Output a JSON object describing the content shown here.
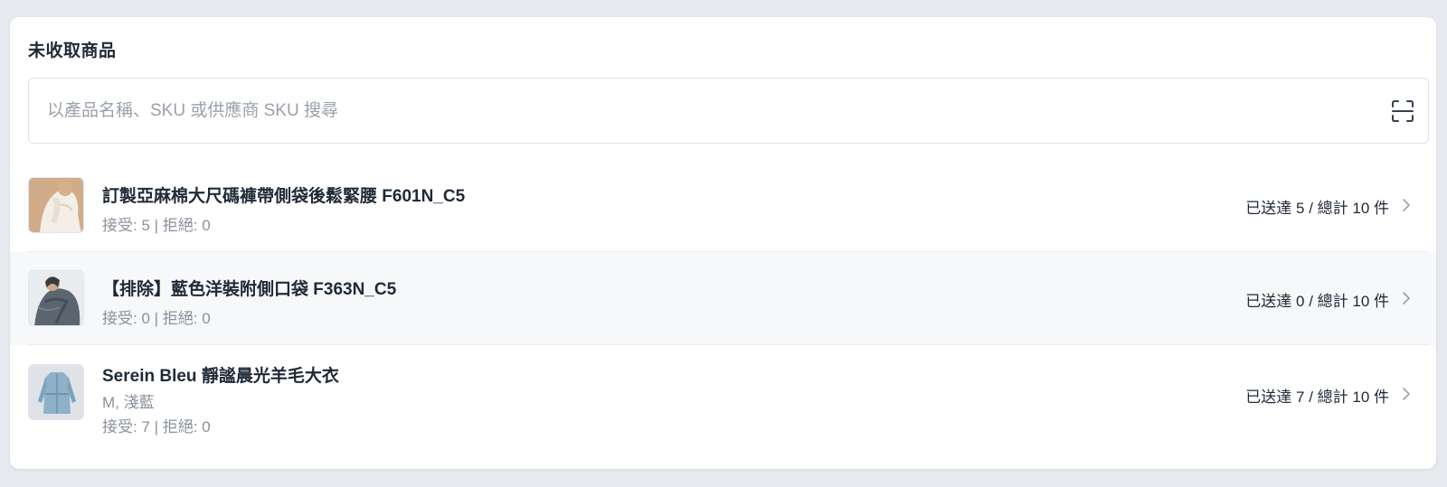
{
  "section": {
    "title": "未收取商品"
  },
  "search": {
    "placeholder": "以產品名稱、SKU 或供應商 SKU 搜尋",
    "value": ""
  },
  "items": [
    {
      "title": "訂製亞麻棉大尺碼褲帶側袋後鬆緊腰 F601N_C5",
      "variant": "",
      "counts": "接受: 5 | 拒絕: 0",
      "status": "已送達 5 / 總計 10 件",
      "thumb_icon": "product-photo-beige"
    },
    {
      "title": "【排除】藍色洋裝附側口袋 F363N_C5",
      "variant": "",
      "counts": "接受: 0 | 拒絕: 0",
      "status": "已送達 0 / 總計 10 件",
      "thumb_icon": "product-photo-grey"
    },
    {
      "title": "Serein Bleu 靜謐晨光羊毛大衣",
      "variant": "M, 淺藍",
      "counts": "接受: 7 | 拒絕: 0",
      "status": "已送達 7 / 總計 10 件",
      "thumb_icon": "product-photo-blue-coat"
    }
  ],
  "colors": {
    "background": "#e6e9ee",
    "card": "#ffffff",
    "row_highlight": "#f6f8fa",
    "text_primary": "#1f2937",
    "text_secondary": "#8a919b"
  }
}
